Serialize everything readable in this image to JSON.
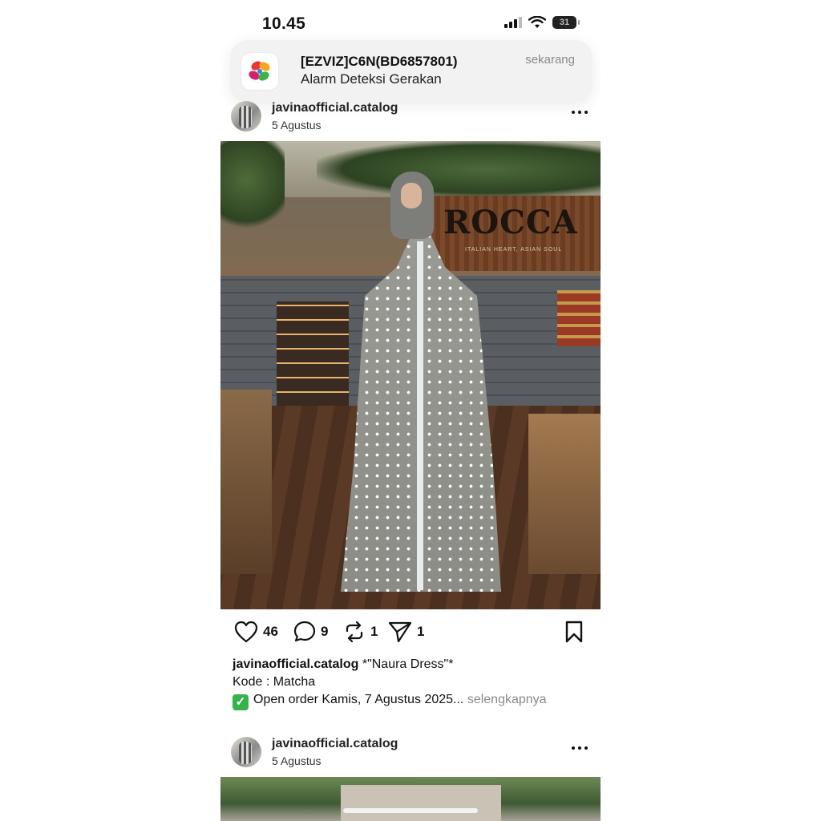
{
  "status_bar": {
    "time": "10.45",
    "battery": "31"
  },
  "notification": {
    "title": "[EZVIZ]C6N(BD6857801)",
    "body": "Alarm Deteksi Gerakan",
    "time": "sekarang"
  },
  "post1": {
    "username": "javinaofficial.catalog",
    "date": "5 Agustus",
    "photo_sign": "ROCCA",
    "photo_sign_sub": "ITALIAN HEART, ASIAN SOUL",
    "likes": "46",
    "comments": "9",
    "reposts": "1",
    "shares": "1",
    "caption": {
      "username": "javinaofficial.catalog",
      "title": "*\"Naura Dress\"*",
      "line2": "Kode : Matcha",
      "line3": "Open order Kamis, 7 Agustus 2025...",
      "more": "selengkapnya"
    }
  },
  "post2": {
    "username": "javinaofficial.catalog",
    "date": "5 Agustus"
  },
  "colors": {
    "more_link": "#8a8a8a",
    "notification_bg": "#f2f2f2"
  }
}
